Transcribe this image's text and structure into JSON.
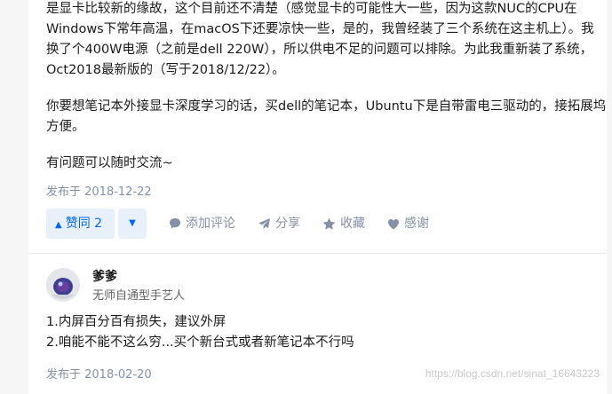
{
  "answer1": {
    "paragraph1": [
      "是显卡比较新的缘故，这个目前还不清楚（感觉显卡的可能性大一些，因为这款NUC的CPU在",
      "Windows下常年高温，在macOS下还要凉快一些，是的，我曾经装了三个系统在这主机上）。我",
      "换了个400W电源（之前是dell 220W），所以供电不足的问题可以排除。为此我重新装了系统，",
      "Oct2018最新版的（写于2018/12/22）。"
    ],
    "paragraph2": [
      "你要想笔记本外接显卡深度学习的话，买dell的笔记本，Ubuntu下是自带雷电三驱动的，接拓展坞",
      "方便。"
    ],
    "paragraph3": "有问题可以随时交流~",
    "date": "发布于 2018-12-22",
    "actions": {
      "upvote": "赞同 2",
      "comment": "添加评论",
      "share": "分享",
      "favorite": "收藏",
      "thanks": "感谢"
    }
  },
  "answer2": {
    "author_name": "爹爹",
    "author_bio": "无师自通型手艺人",
    "lines": [
      "1.内屏百分百有损失，建议外屏",
      "2.咱能不能不这么穷...买个新台式或者新笔记本不行吗"
    ],
    "date": "发布于 2018-02-20"
  },
  "watermark": "https://blog.csdn.net/sinat_16643223",
  "colors": {
    "accent": "#0066ff",
    "accent_bg": "#e8f1fb",
    "meta": "#8590a6"
  }
}
